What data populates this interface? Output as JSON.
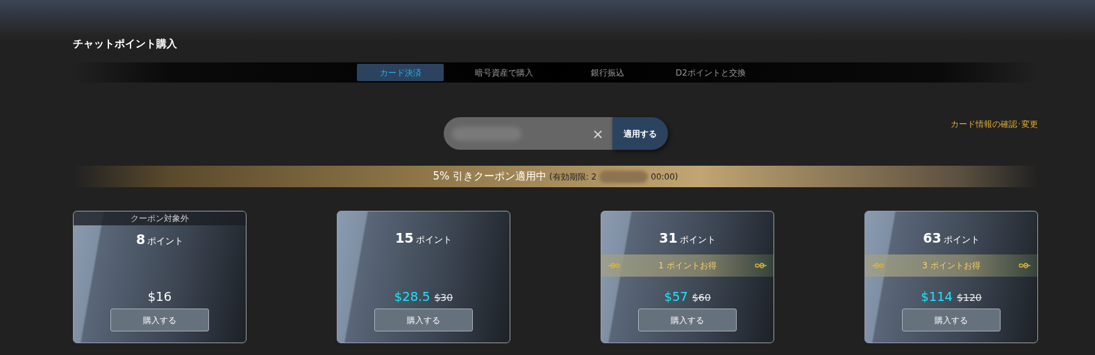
{
  "page_title": "チャットポイント購入",
  "tabs": [
    {
      "label": "カード決済",
      "selected": true
    },
    {
      "label": "暗号資産で購入",
      "selected": false
    },
    {
      "label": "銀行振込",
      "selected": false
    },
    {
      "label": "D2ポイントと交換",
      "selected": false
    }
  ],
  "coupon": {
    "clear": "×",
    "apply_button": "適用する"
  },
  "card_link": "カード情報の確認･変更",
  "banner": {
    "headline": "5% 引きクーポン適用中",
    "expiry_prefix": "(有効期限: 2",
    "expiry_suffix": "00:00)"
  },
  "plans": [
    {
      "header": "クーポン対象外",
      "points": "8",
      "unit": "ポイント",
      "price": "$16",
      "discounted": false,
      "button": "購入する"
    },
    {
      "points": "15",
      "unit": "ポイント",
      "price": "$28.5",
      "original_price": "$30",
      "discounted": true,
      "button": "購入する"
    },
    {
      "points": "31",
      "unit": "ポイント",
      "bonus": "1 ポイントお得",
      "price": "$57",
      "original_price": "$60",
      "discounted": true,
      "button": "購入する"
    },
    {
      "points": "63",
      "unit": "ポイント",
      "bonus": "3 ポイントお得",
      "price": "$114",
      "original_price": "$120",
      "discounted": true,
      "button": "購入する"
    }
  ]
}
